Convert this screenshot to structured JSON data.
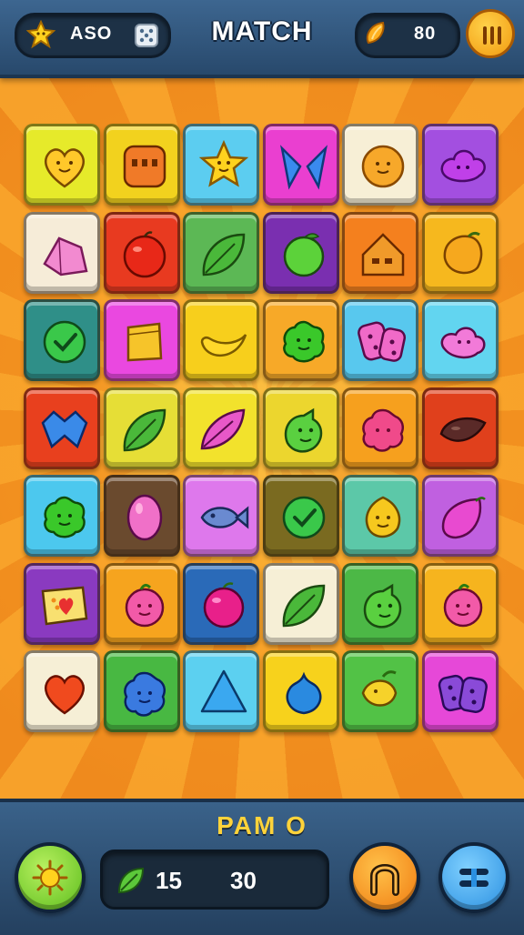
{
  "header": {
    "title": "MATCH",
    "left_counter": "ASO",
    "right_counter": "80",
    "icons": [
      "star-icon",
      "dice-icon",
      "coin-icon",
      "pause-icon"
    ]
  },
  "board": {
    "rows": 7,
    "cols": 6,
    "tiles": [
      [
        {
          "color": "#e6ea2a",
          "item": "heart-face"
        },
        {
          "color": "#f2d21e",
          "item": "orange-block"
        },
        {
          "color": "#5ccdf0",
          "item": "star-face"
        },
        {
          "color": "#ea3fd0",
          "item": "blue-wings"
        },
        {
          "color": "#f7efd6",
          "item": "orange-ball"
        },
        {
          "color": "#a34fe0",
          "item": "purple-cloud"
        }
      ],
      [
        {
          "color": "#f6ecd8",
          "item": "pink-gem"
        },
        {
          "color": "#e83a20",
          "item": "red-apple"
        },
        {
          "color": "#5cb855",
          "item": "green-leaf"
        },
        {
          "color": "#7a2fb0",
          "item": "green-apple"
        },
        {
          "color": "#f4801e",
          "item": "house"
        },
        {
          "color": "#f6b81e",
          "item": "orange-fruit"
        }
      ],
      [
        {
          "color": "#2f8f88",
          "item": "green-check"
        },
        {
          "color": "#ea48e0",
          "item": "yellow-block"
        },
        {
          "color": "#f7cf1c",
          "item": "banana"
        },
        {
          "color": "#f7a928",
          "item": "green-blob"
        },
        {
          "color": "#58c8ee",
          "item": "pink-dice"
        },
        {
          "color": "#62d5f0",
          "item": "pink-cloud"
        }
      ],
      [
        {
          "color": "#e8401e",
          "item": "blue-gem"
        },
        {
          "color": "#e6de36",
          "item": "green-leaf"
        },
        {
          "color": "#f2e22c",
          "item": "pink-leaf"
        },
        {
          "color": "#ecd62e",
          "item": "green-dragon"
        },
        {
          "color": "#f6a01e",
          "item": "pink-berry"
        },
        {
          "color": "#e0401c",
          "item": "brown-seed"
        }
      ],
      [
        {
          "color": "#4cc8ee",
          "item": "green-blob"
        },
        {
          "color": "#6a4a2e",
          "item": "pink-egg"
        },
        {
          "color": "#de78ec",
          "item": "blue-fish"
        },
        {
          "color": "#7a6a20",
          "item": "green-check"
        },
        {
          "color": "#5cc8a8",
          "item": "yellow-lemon"
        },
        {
          "color": "#c060e0",
          "item": "pink-fruit"
        }
      ],
      [
        {
          "color": "#8a3ac0",
          "item": "heart-card"
        },
        {
          "color": "#f6a41e",
          "item": "pink-flower"
        },
        {
          "color": "#2a6ab8",
          "item": "pink-apple"
        },
        {
          "color": "#f6efd6",
          "item": "green-leaf"
        },
        {
          "color": "#4cb846",
          "item": "green-dragon"
        },
        {
          "color": "#f6b41e",
          "item": "pink-flower"
        }
      ],
      [
        {
          "color": "#f6efd6",
          "item": "red-heart"
        },
        {
          "color": "#48b842",
          "item": "blue-blob"
        },
        {
          "color": "#5cd0f0",
          "item": "blue-triangle"
        },
        {
          "color": "#f7d21c",
          "item": "blue-drop"
        },
        {
          "color": "#52c246",
          "item": "yellow-fish"
        },
        {
          "color": "#e648d8",
          "item": "purple-dice"
        }
      ]
    ]
  },
  "footer": {
    "label": "PAM O",
    "moves": "15",
    "score": "30",
    "icons": [
      "sun-icon",
      "leaf-icon",
      "magnet-icon",
      "menu-icon"
    ]
  },
  "colors": {
    "header_bg": "#315780",
    "accent": "#ffd33a",
    "board_bg": "#f08a1c"
  }
}
